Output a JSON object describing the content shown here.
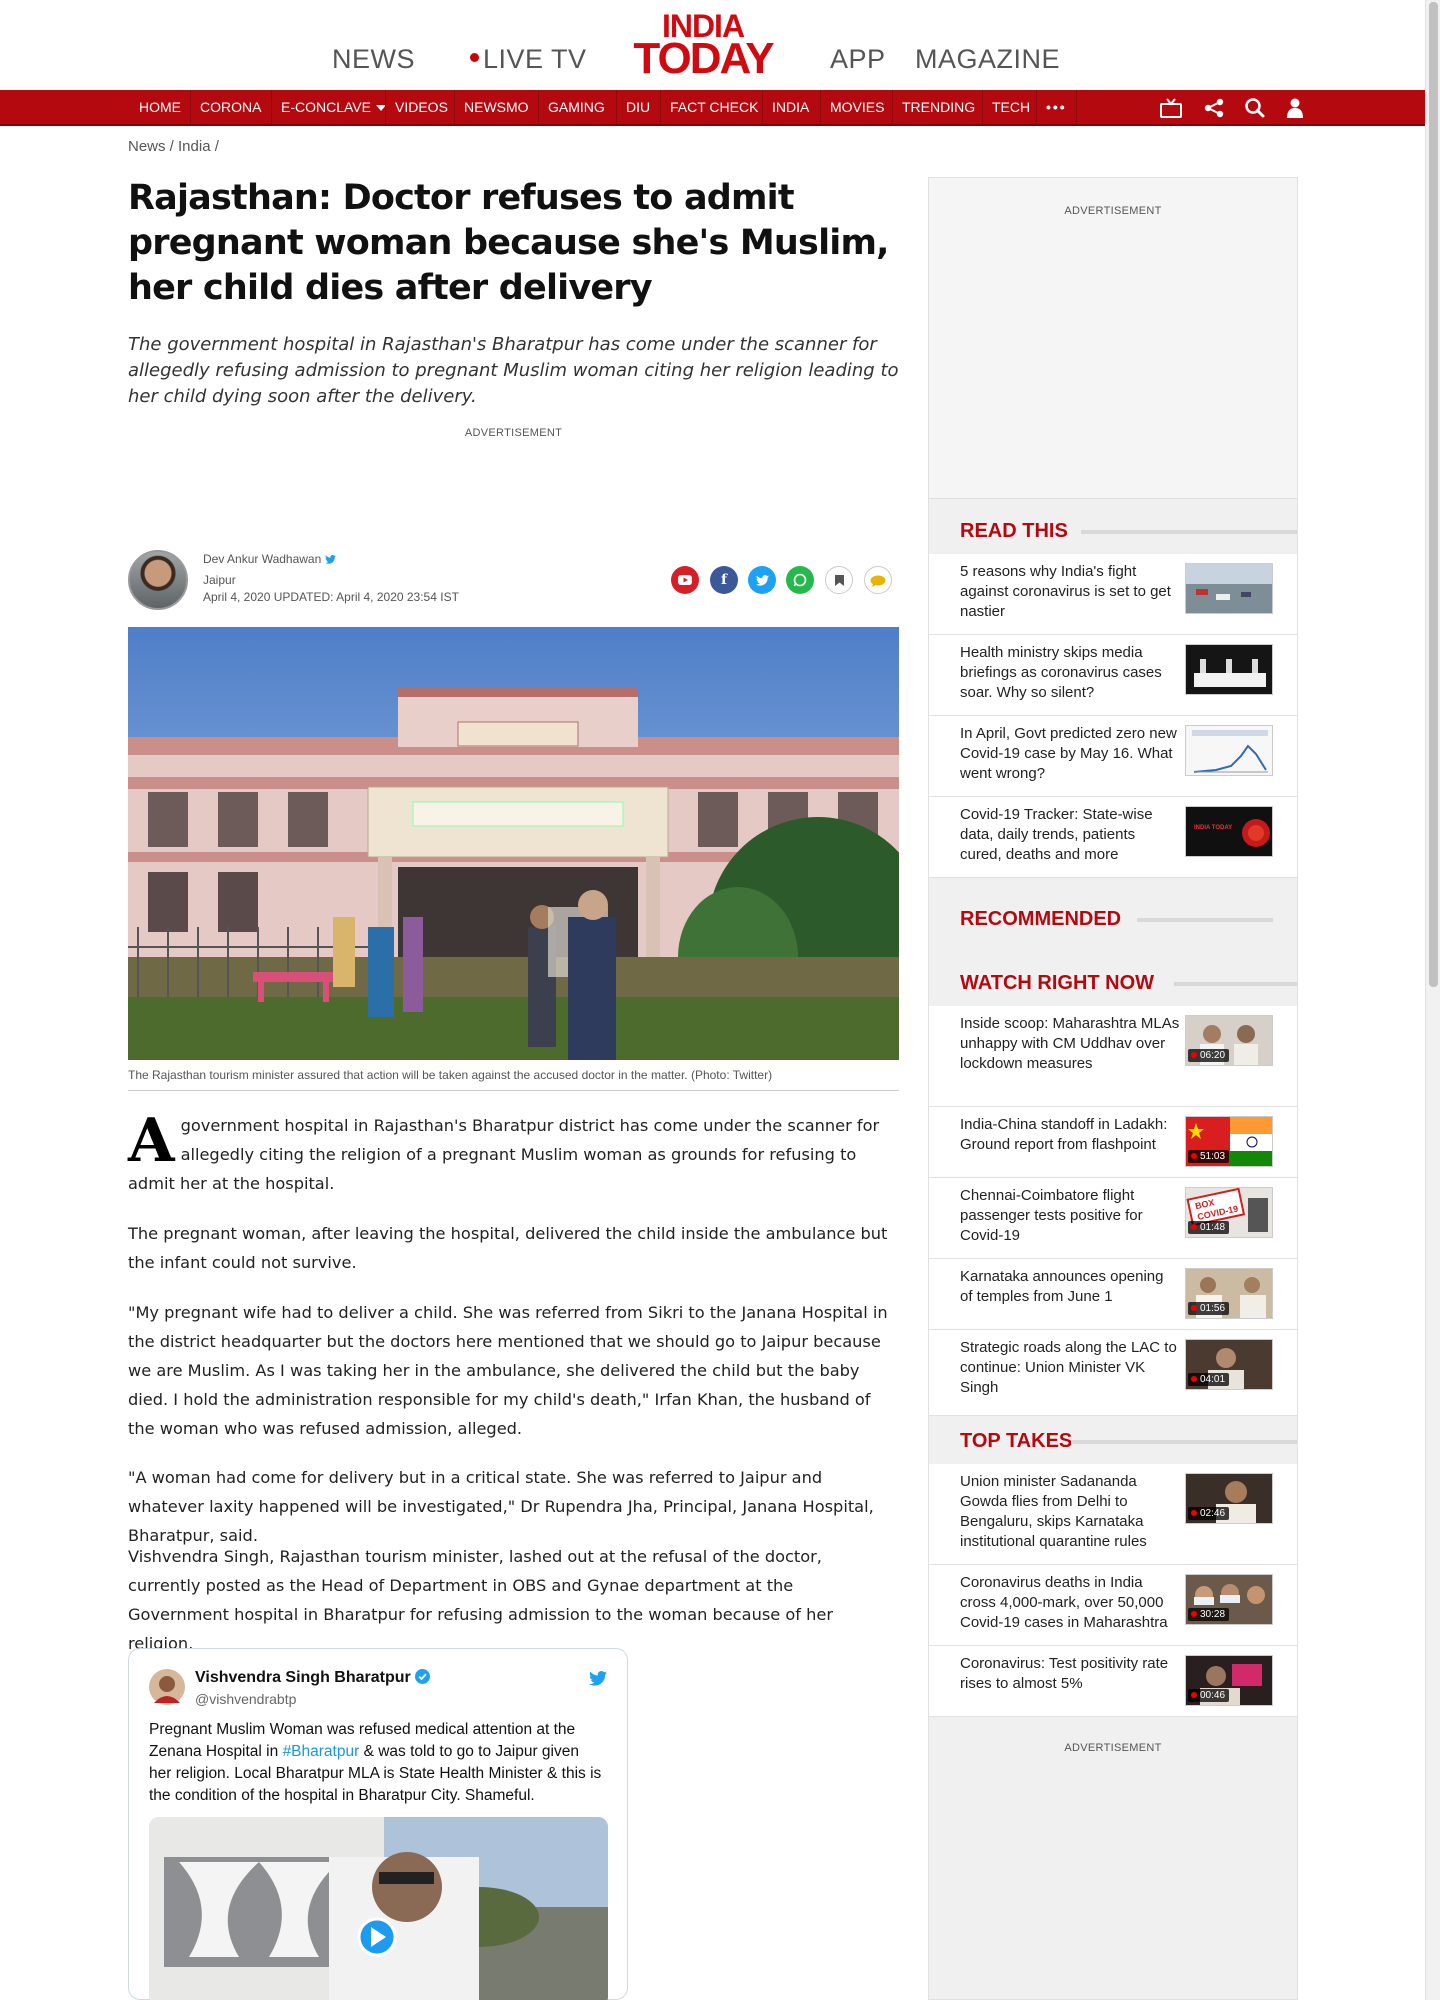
{
  "header": {
    "nav_left": [
      "NEWS",
      "LIVE TV"
    ],
    "nav_right": [
      "APP",
      "MAGAZINE"
    ],
    "logo_line1": "INDIA",
    "logo_line2": "TODAY",
    "brand_color": "#d10a11"
  },
  "rednav": {
    "items": [
      "HOME",
      "CORONA",
      "E-CONCLAVE",
      "VIDEOS",
      "NEWSMO",
      "GAMING",
      "DIU",
      "FACT CHECK",
      "INDIA",
      "MOVIES",
      "TRENDING",
      "TECH"
    ],
    "more": "•••",
    "icons": [
      "tv-icon",
      "share-icon",
      "search-icon",
      "user-icon"
    ],
    "bg_color": "#b4090f"
  },
  "breadcrumb": "News / India /",
  "article": {
    "headline": "Rajasthan: Doctor refuses to admit pregnant woman because she's Muslim, her child dies after delivery",
    "summary": "The government hospital in Rajasthan's Bharatpur has come under the scanner for allegedly refusing admission to pregnant Muslim woman citing her religion leading to her child dying soon after the delivery.",
    "ad_label": "ADVERTISEMENT",
    "author": "Dev Ankur Wadhawan",
    "location": "Jaipur",
    "dates": "April 4, 2020  UPDATED: April 4, 2020 23:54 IST",
    "share_icons": [
      "youtube-icon",
      "facebook-icon",
      "twitter-icon",
      "whatsapp-icon",
      "bookmark-icon",
      "comment-icon"
    ],
    "image_caption": "The Rajasthan tourism minister assured that action will be taken against the accused doctor in the matter. (Photo: Twitter)",
    "dropcap": "A",
    "paragraphs": [
      "government hospital in Rajasthan's Bharatpur district has come under the scanner for allegedly citing the religion of a pregnant Muslim woman as grounds for refusing to admit her at the hospital.",
      "The pregnant woman, after leaving the hospital, delivered the child inside the ambulance but the infant could not survive.",
      "\"My pregnant wife had to deliver a child. She was referred from Sikri to the Janana Hospital in the district headquarter but the doctors here mentioned that we should go to Jaipur because we are Muslim. As I was taking her in the ambulance, she delivered the child but the baby died. I hold the administration responsible for my child's death,\" Irfan Khan, the husband of the woman who was refused admission, alleged.",
      "\"A woman had come for delivery but in a critical state. She was referred to Jaipur and whatever laxity happened will be investigated,\" Dr Rupendra Jha, Principal, Janana Hospital, Bharatpur, said.",
      "Vishvendra Singh, Rajasthan tourism minister, lashed out at the refusal of the doctor, currently posted as the Head of Department in OBS and Gynae department at the Government hospital in Bharatpur for refusing admission to the woman because of her religion."
    ]
  },
  "tweet": {
    "name": "Vishvendra Singh Bharatpur",
    "handle": "@vishvendrabtp",
    "text_before": "Pregnant Muslim Woman was refused medical attention at the Zenana Hospital in ",
    "hashtag": "#Bharatpur",
    "text_after": " & was told to go to Jaipur given her religion. Local Bharatpur MLA is State Health Minister & this is the condition of the hospital in Bharatpur City. Shameful."
  },
  "sidebar": {
    "ad_label": "ADVERTISEMENT",
    "read_this": {
      "title": "READ THIS",
      "items": [
        "5 reasons why India's fight against coronavirus is set to get nastier",
        "Health ministry skips media briefings as coronavirus cases soar. Why so silent?",
        "In April, Govt predicted zero new Covid-19 case by May 16. What went wrong?",
        "Covid-19 Tracker: State-wise data, daily trends, patients cured, deaths and more"
      ]
    },
    "recommended": {
      "title": "RECOMMENDED"
    },
    "watch": {
      "title": "WATCH RIGHT NOW",
      "items": [
        {
          "text": "Inside scoop: Maharashtra MLAs unhappy with CM Uddhav over lockdown measures",
          "duration": "06:20"
        },
        {
          "text": "India-China standoff in Ladakh: Ground report from flashpoint",
          "duration": "51:03"
        },
        {
          "text": "Chennai-Coimbatore flight passenger tests positive for Covid-19",
          "duration": "01:48"
        },
        {
          "text": "Karnataka announces opening of temples from June 1",
          "duration": "01:56"
        },
        {
          "text": "Strategic roads along the LAC to continue: Union Minister VK Singh",
          "duration": "04:01"
        }
      ]
    },
    "top_takes": {
      "title": "TOP TAKES",
      "items": [
        {
          "text": "Union minister Sadananda Gowda flies from Delhi to Bengaluru, skips Karnataka institutional quarantine rules",
          "duration": "02:46"
        },
        {
          "text": "Coronavirus deaths in India cross 4,000-mark, over 50,000 Covid-19 cases in Maharashtra",
          "duration": "30:28"
        },
        {
          "text": "Coronavirus: Test positivity rate rises to almost 5%",
          "duration": "00:46"
        }
      ]
    },
    "thumb_texts": {
      "box_covid": "BOX\nCOVID-19",
      "tracker": "INDIA TODAY"
    }
  }
}
